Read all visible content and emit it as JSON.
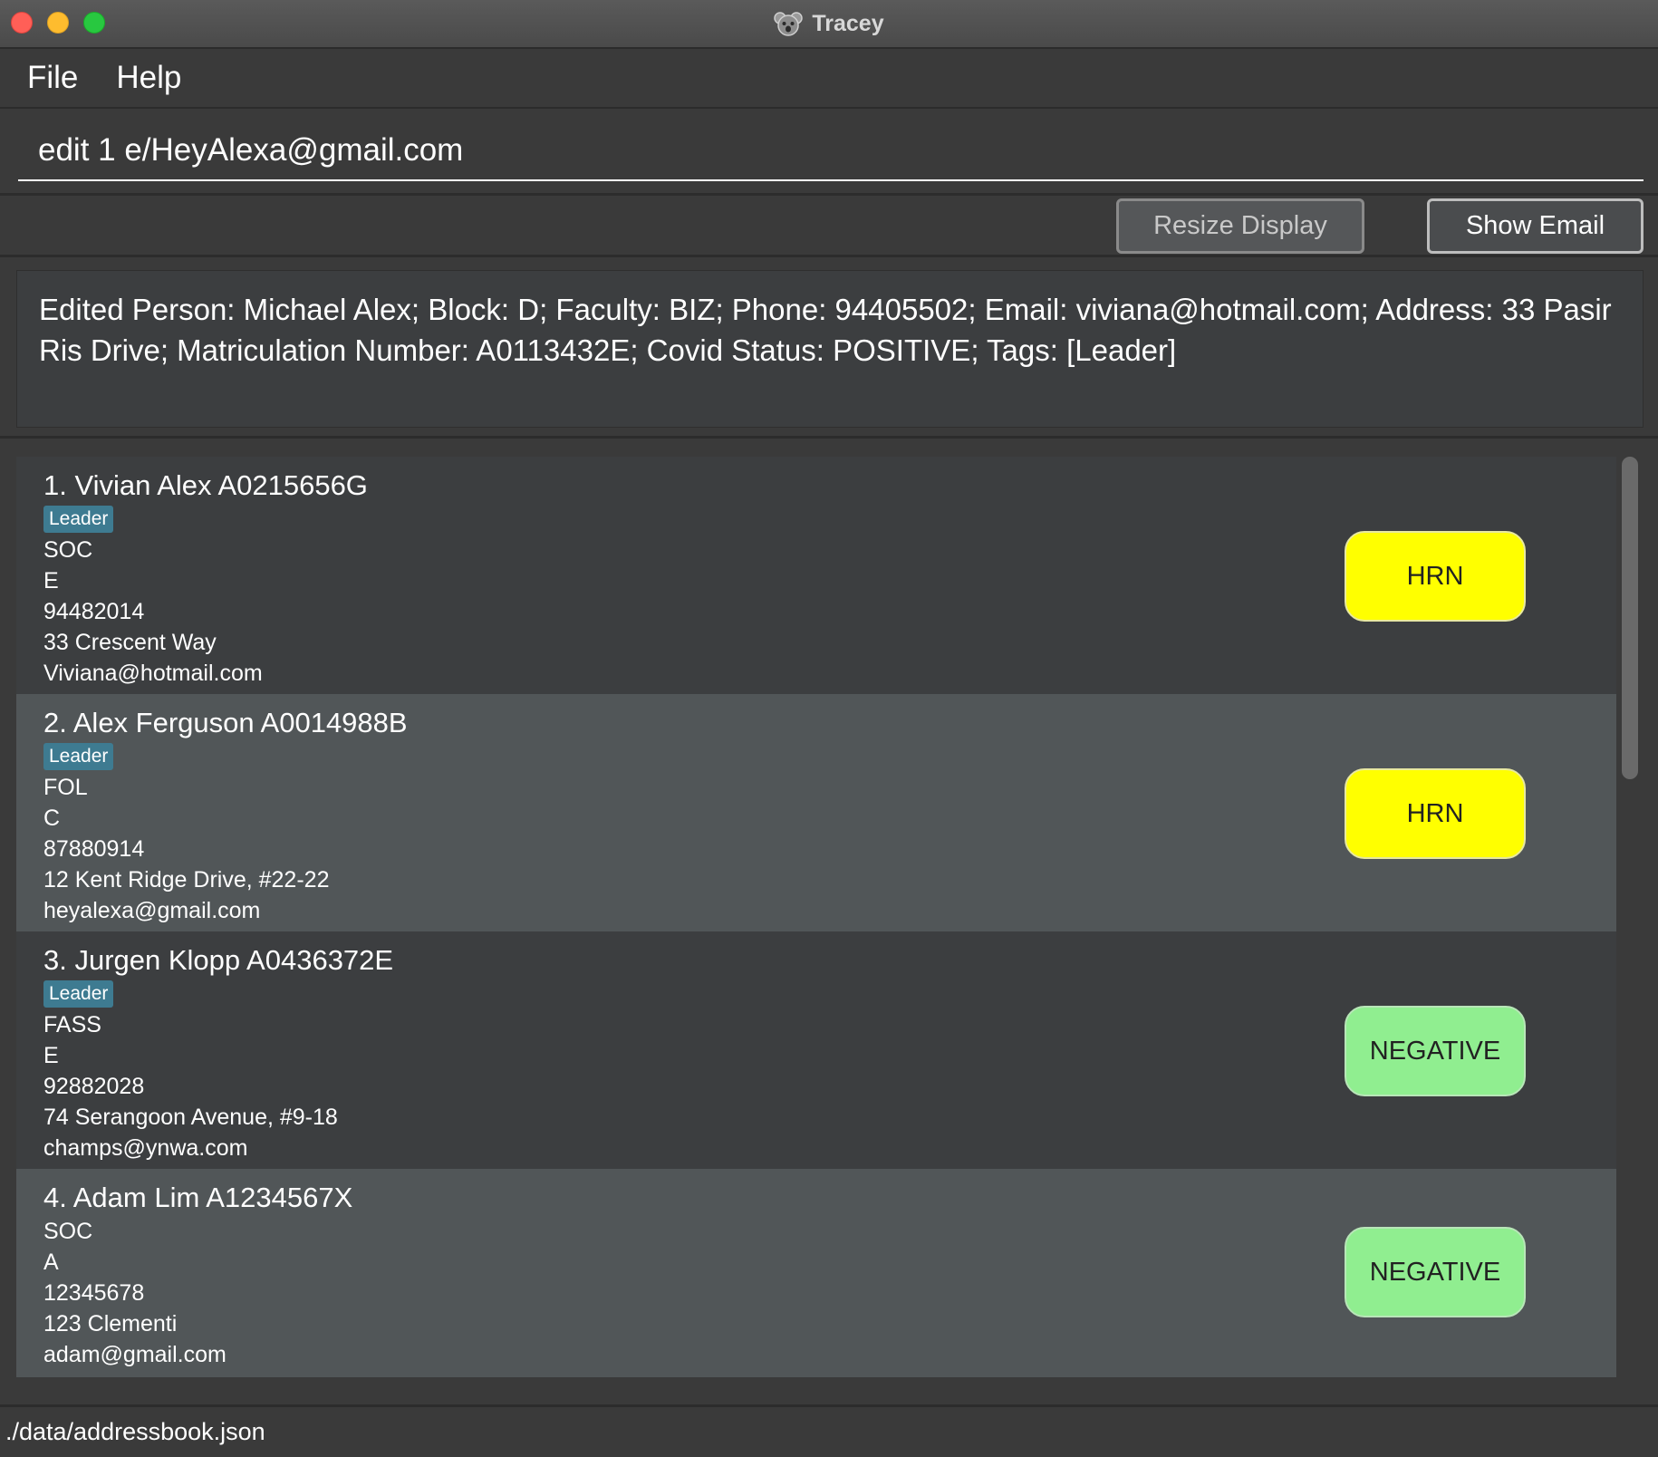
{
  "window": {
    "title": "Tracey",
    "icon": "koala-app-icon"
  },
  "menu": {
    "items": [
      {
        "label": "File"
      },
      {
        "label": "Help"
      }
    ]
  },
  "command": {
    "value": "edit 1 e/HeyAlexa@gmail.com"
  },
  "buttons": {
    "resize_label": "Resize Display",
    "email_label": "Show Email"
  },
  "result": {
    "text": "Edited Person: Michael Alex; Block: D; Faculty: BIZ; Phone: 94405502; Email: viviana@hotmail.com; Address: 33 Pasir Ris Drive; Matriculation Number: A0113432E; Covid Status: POSITIVE; Tags: [Leader]"
  },
  "persons": [
    {
      "title": "1.  Vivian Alex A0215656G",
      "tag": "Leader",
      "faculty": "SOC",
      "block": "E",
      "phone": "94482014",
      "address": "33 Crescent Way",
      "email": "Viviana@hotmail.com",
      "status": "HRN"
    },
    {
      "title": "2.  Alex Ferguson A0014988B",
      "tag": "Leader",
      "faculty": "FOL",
      "block": "C",
      "phone": "87880914",
      "address": "12 Kent Ridge Drive, #22-22",
      "email": "heyalexa@gmail.com",
      "status": "HRN"
    },
    {
      "title": "3.  Jurgen Klopp A0436372E",
      "tag": "Leader",
      "faculty": "FASS",
      "block": "E",
      "phone": "92882028",
      "address": "74 Serangoon Avenue, #9-18",
      "email": "champs@ynwa.com",
      "status": "NEGATIVE"
    },
    {
      "title": "4.  Adam Lim A1234567X",
      "tag": null,
      "faculty": "SOC",
      "block": "A",
      "phone": "12345678",
      "address": "123 Clementi",
      "email": "adam@gmail.com",
      "status": "NEGATIVE"
    }
  ],
  "colors": {
    "hrn": "#ffff00",
    "negative": "#90ee90",
    "tag": "#3e7b91"
  },
  "statusbar": {
    "path": "./data/addressbook.json"
  }
}
